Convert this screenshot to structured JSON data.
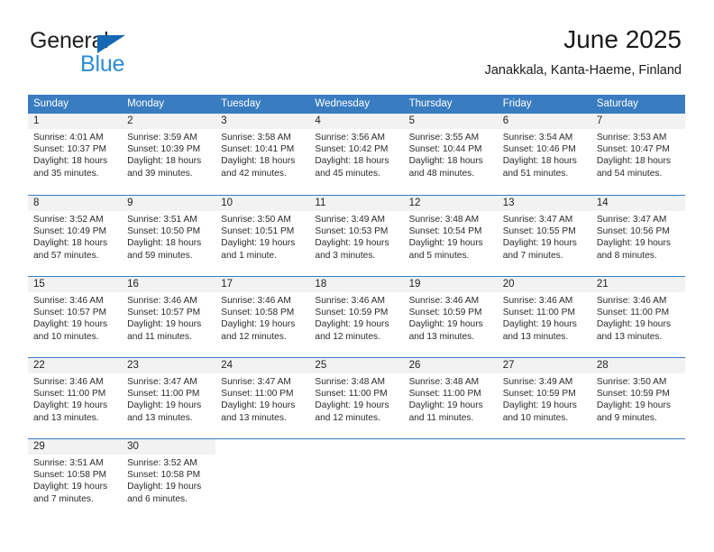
{
  "brand": {
    "line1": "General",
    "line2": "Blue",
    "triangle_color": "#1568b4",
    "line2_color": "#2b8cd6"
  },
  "header": {
    "title": "June 2025",
    "subtitle": "Janakkala, Kanta-Haeme, Finland"
  },
  "theme": {
    "header_blue": "#3a7cc0",
    "daynum_band": "#f2f2f2",
    "text": "#222222"
  },
  "calendar": {
    "weekdays": [
      "Sunday",
      "Monday",
      "Tuesday",
      "Wednesday",
      "Thursday",
      "Friday",
      "Saturday"
    ],
    "weeks": [
      [
        {
          "day": "1",
          "sunrise": "Sunrise: 4:01 AM",
          "sunset": "Sunset: 10:37 PM",
          "daylight1": "Daylight: 18 hours",
          "daylight2": "and 35 minutes."
        },
        {
          "day": "2",
          "sunrise": "Sunrise: 3:59 AM",
          "sunset": "Sunset: 10:39 PM",
          "daylight1": "Daylight: 18 hours",
          "daylight2": "and 39 minutes."
        },
        {
          "day": "3",
          "sunrise": "Sunrise: 3:58 AM",
          "sunset": "Sunset: 10:41 PM",
          "daylight1": "Daylight: 18 hours",
          "daylight2": "and 42 minutes."
        },
        {
          "day": "4",
          "sunrise": "Sunrise: 3:56 AM",
          "sunset": "Sunset: 10:42 PM",
          "daylight1": "Daylight: 18 hours",
          "daylight2": "and 45 minutes."
        },
        {
          "day": "5",
          "sunrise": "Sunrise: 3:55 AM",
          "sunset": "Sunset: 10:44 PM",
          "daylight1": "Daylight: 18 hours",
          "daylight2": "and 48 minutes."
        },
        {
          "day": "6",
          "sunrise": "Sunrise: 3:54 AM",
          "sunset": "Sunset: 10:46 PM",
          "daylight1": "Daylight: 18 hours",
          "daylight2": "and 51 minutes."
        },
        {
          "day": "7",
          "sunrise": "Sunrise: 3:53 AM",
          "sunset": "Sunset: 10:47 PM",
          "daylight1": "Daylight: 18 hours",
          "daylight2": "and 54 minutes."
        }
      ],
      [
        {
          "day": "8",
          "sunrise": "Sunrise: 3:52 AM",
          "sunset": "Sunset: 10:49 PM",
          "daylight1": "Daylight: 18 hours",
          "daylight2": "and 57 minutes."
        },
        {
          "day": "9",
          "sunrise": "Sunrise: 3:51 AM",
          "sunset": "Sunset: 10:50 PM",
          "daylight1": "Daylight: 18 hours",
          "daylight2": "and 59 minutes."
        },
        {
          "day": "10",
          "sunrise": "Sunrise: 3:50 AM",
          "sunset": "Sunset: 10:51 PM",
          "daylight1": "Daylight: 19 hours",
          "daylight2": "and 1 minute."
        },
        {
          "day": "11",
          "sunrise": "Sunrise: 3:49 AM",
          "sunset": "Sunset: 10:53 PM",
          "daylight1": "Daylight: 19 hours",
          "daylight2": "and 3 minutes."
        },
        {
          "day": "12",
          "sunrise": "Sunrise: 3:48 AM",
          "sunset": "Sunset: 10:54 PM",
          "daylight1": "Daylight: 19 hours",
          "daylight2": "and 5 minutes."
        },
        {
          "day": "13",
          "sunrise": "Sunrise: 3:47 AM",
          "sunset": "Sunset: 10:55 PM",
          "daylight1": "Daylight: 19 hours",
          "daylight2": "and 7 minutes."
        },
        {
          "day": "14",
          "sunrise": "Sunrise: 3:47 AM",
          "sunset": "Sunset: 10:56 PM",
          "daylight1": "Daylight: 19 hours",
          "daylight2": "and 8 minutes."
        }
      ],
      [
        {
          "day": "15",
          "sunrise": "Sunrise: 3:46 AM",
          "sunset": "Sunset: 10:57 PM",
          "daylight1": "Daylight: 19 hours",
          "daylight2": "and 10 minutes."
        },
        {
          "day": "16",
          "sunrise": "Sunrise: 3:46 AM",
          "sunset": "Sunset: 10:57 PM",
          "daylight1": "Daylight: 19 hours",
          "daylight2": "and 11 minutes."
        },
        {
          "day": "17",
          "sunrise": "Sunrise: 3:46 AM",
          "sunset": "Sunset: 10:58 PM",
          "daylight1": "Daylight: 19 hours",
          "daylight2": "and 12 minutes."
        },
        {
          "day": "18",
          "sunrise": "Sunrise: 3:46 AM",
          "sunset": "Sunset: 10:59 PM",
          "daylight1": "Daylight: 19 hours",
          "daylight2": "and 12 minutes."
        },
        {
          "day": "19",
          "sunrise": "Sunrise: 3:46 AM",
          "sunset": "Sunset: 10:59 PM",
          "daylight1": "Daylight: 19 hours",
          "daylight2": "and 13 minutes."
        },
        {
          "day": "20",
          "sunrise": "Sunrise: 3:46 AM",
          "sunset": "Sunset: 11:00 PM",
          "daylight1": "Daylight: 19 hours",
          "daylight2": "and 13 minutes."
        },
        {
          "day": "21",
          "sunrise": "Sunrise: 3:46 AM",
          "sunset": "Sunset: 11:00 PM",
          "daylight1": "Daylight: 19 hours",
          "daylight2": "and 13 minutes."
        }
      ],
      [
        {
          "day": "22",
          "sunrise": "Sunrise: 3:46 AM",
          "sunset": "Sunset: 11:00 PM",
          "daylight1": "Daylight: 19 hours",
          "daylight2": "and 13 minutes."
        },
        {
          "day": "23",
          "sunrise": "Sunrise: 3:47 AM",
          "sunset": "Sunset: 11:00 PM",
          "daylight1": "Daylight: 19 hours",
          "daylight2": "and 13 minutes."
        },
        {
          "day": "24",
          "sunrise": "Sunrise: 3:47 AM",
          "sunset": "Sunset: 11:00 PM",
          "daylight1": "Daylight: 19 hours",
          "daylight2": "and 13 minutes."
        },
        {
          "day": "25",
          "sunrise": "Sunrise: 3:48 AM",
          "sunset": "Sunset: 11:00 PM",
          "daylight1": "Daylight: 19 hours",
          "daylight2": "and 12 minutes."
        },
        {
          "day": "26",
          "sunrise": "Sunrise: 3:48 AM",
          "sunset": "Sunset: 11:00 PM",
          "daylight1": "Daylight: 19 hours",
          "daylight2": "and 11 minutes."
        },
        {
          "day": "27",
          "sunrise": "Sunrise: 3:49 AM",
          "sunset": "Sunset: 10:59 PM",
          "daylight1": "Daylight: 19 hours",
          "daylight2": "and 10 minutes."
        },
        {
          "day": "28",
          "sunrise": "Sunrise: 3:50 AM",
          "sunset": "Sunset: 10:59 PM",
          "daylight1": "Daylight: 19 hours",
          "daylight2": "and 9 minutes."
        }
      ],
      [
        {
          "day": "29",
          "sunrise": "Sunrise: 3:51 AM",
          "sunset": "Sunset: 10:58 PM",
          "daylight1": "Daylight: 19 hours",
          "daylight2": "and 7 minutes."
        },
        {
          "day": "30",
          "sunrise": "Sunrise: 3:52 AM",
          "sunset": "Sunset: 10:58 PM",
          "daylight1": "Daylight: 19 hours",
          "daylight2": "and 6 minutes."
        },
        {
          "day": "",
          "sunrise": "",
          "sunset": "",
          "daylight1": "",
          "daylight2": ""
        },
        {
          "day": "",
          "sunrise": "",
          "sunset": "",
          "daylight1": "",
          "daylight2": ""
        },
        {
          "day": "",
          "sunrise": "",
          "sunset": "",
          "daylight1": "",
          "daylight2": ""
        },
        {
          "day": "",
          "sunrise": "",
          "sunset": "",
          "daylight1": "",
          "daylight2": ""
        },
        {
          "day": "",
          "sunrise": "",
          "sunset": "",
          "daylight1": "",
          "daylight2": ""
        }
      ]
    ]
  }
}
